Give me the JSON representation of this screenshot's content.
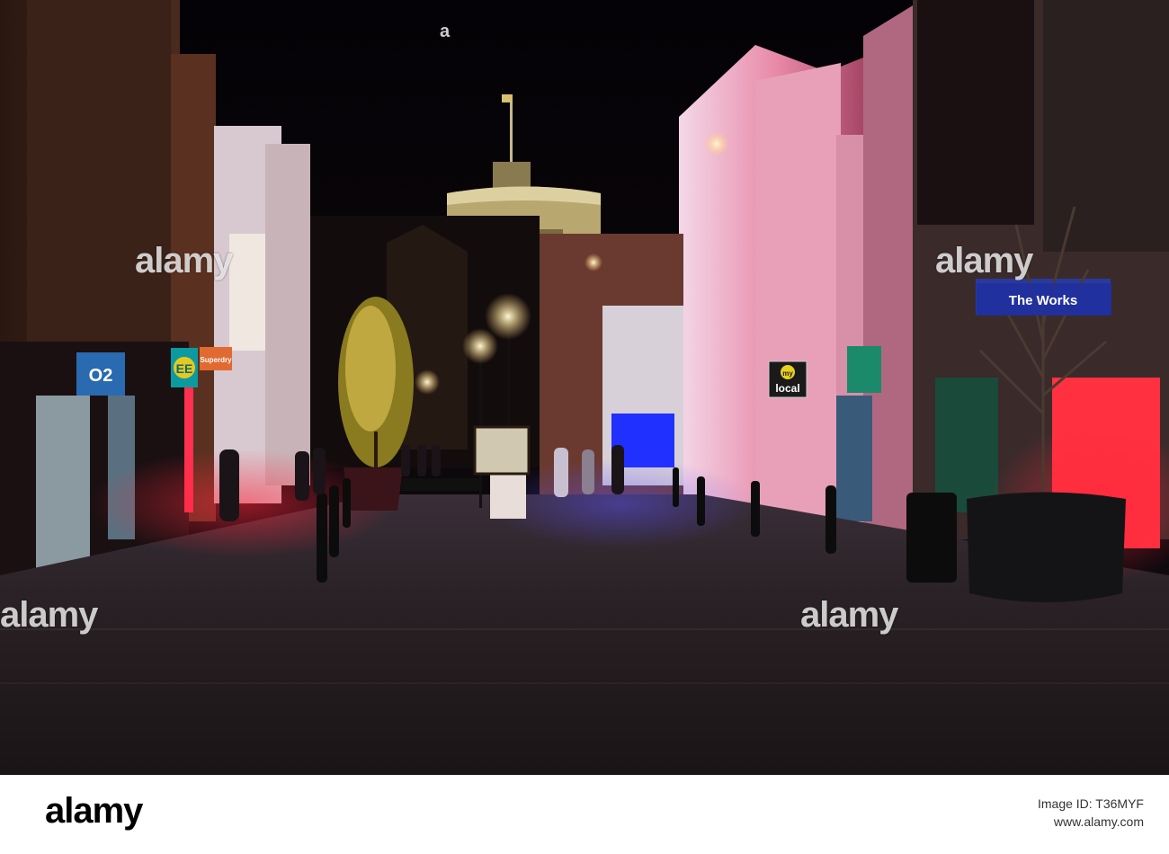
{
  "watermark": {
    "brand": "alamy",
    "image_id": "T36MYF"
  },
  "footer": {
    "logo": "alamy",
    "image_id_label": "Image ID: T36MYF",
    "site": "www.alamy.com"
  },
  "signs": {
    "o2": "O2",
    "ee": "EE",
    "superdry": "Superdry",
    "local": "local",
    "local_prefix": "my",
    "waterstones": "The Works"
  },
  "colors": {
    "sky": "#050308",
    "street_light": "#ffe9b0",
    "pink_glow": "#e06080",
    "blue_glow": "#3a4cff",
    "red_glow": "#ff2030"
  }
}
